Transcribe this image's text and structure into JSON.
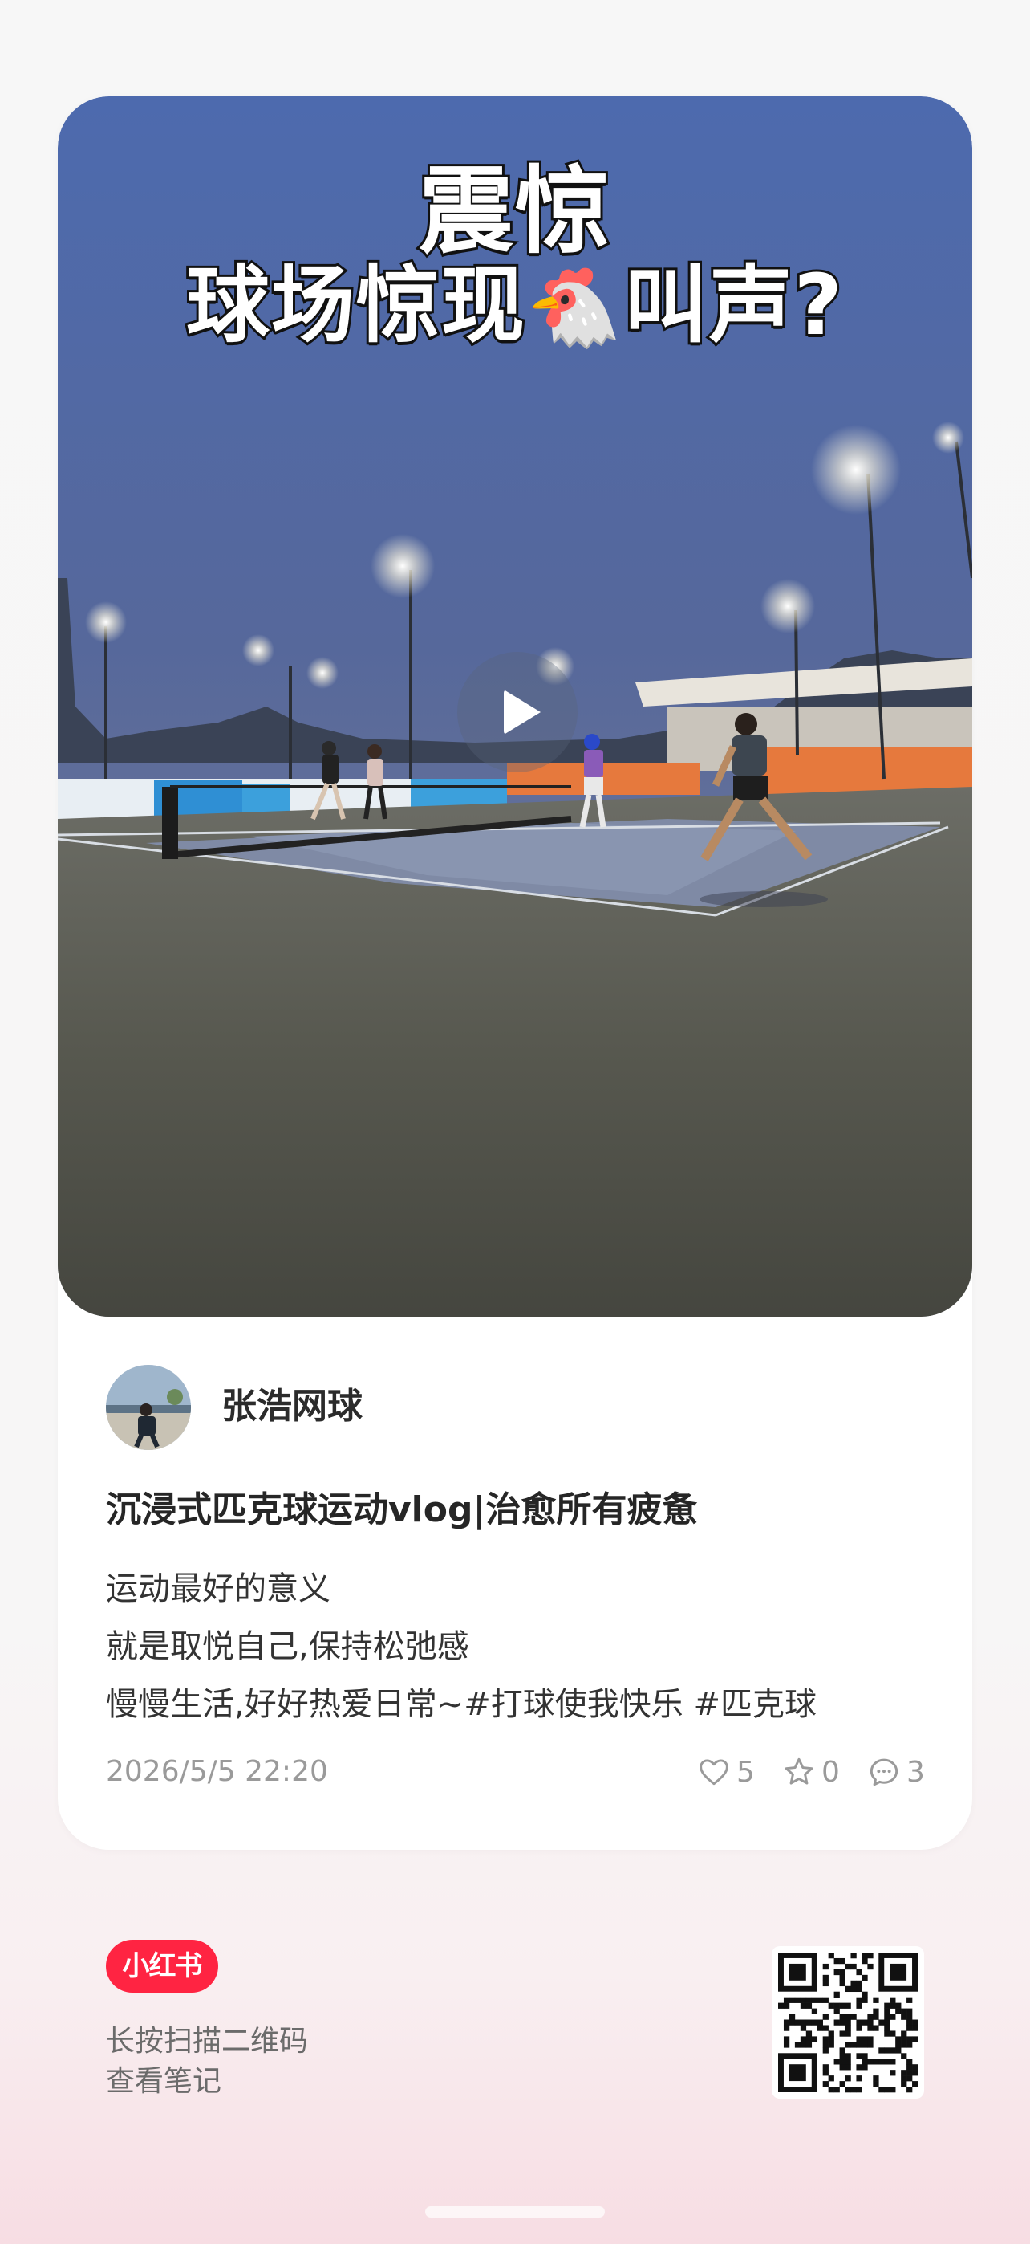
{
  "cover": {
    "title_line1": "震惊",
    "title_line2_before": "球场惊现",
    "title_emoji": "🐔",
    "title_line2_after": "叫声?",
    "media_type": "video",
    "play_icon": "play-icon"
  },
  "author": {
    "name": "张浩网球",
    "avatar_icon": "avatar-photo"
  },
  "note": {
    "title": "沉浸式匹克球运动vlog|治愈所有疲惫",
    "body_lines": [
      "运动最好的意义",
      "就是取悦自己,保持松弛感",
      "慢慢生活,好好热爱日常~#打球使我快乐  #匹克球"
    ]
  },
  "meta": {
    "time": "2026/5/5 22:20",
    "likes": "5",
    "collects": "0",
    "comments": "3",
    "like_icon": "heart-icon",
    "collect_icon": "star-icon",
    "comment_icon": "comment-icon"
  },
  "footer": {
    "brand": "小红书",
    "hint_line1": "长按扫描二维码",
    "hint_line2": "查看笔记",
    "qr_icon": "qr-code"
  },
  "colors": {
    "brand_red": "#ff2442",
    "text_primary": "#262626",
    "text_secondary": "#9a9a9a"
  }
}
